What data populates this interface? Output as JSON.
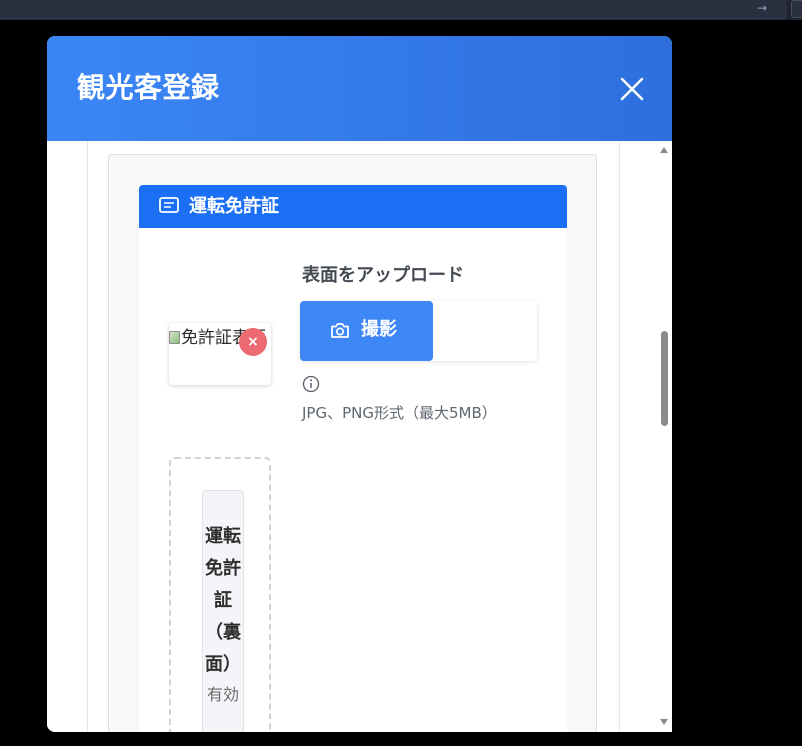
{
  "modal": {
    "title": "観光客登録",
    "close_icon": "close-icon"
  },
  "license_card": {
    "icon": "card-icon",
    "title": "運転免許証",
    "front": {
      "image_alt": "免許証表面",
      "remove_label": "×",
      "remove_color": "#ec6a72",
      "upload_heading": "表面をアップロード",
      "shoot_label": "撮影",
      "shoot_icon": "camera-icon",
      "info_icon": "info-icon",
      "format_hint": "JPG、PNG形式（最大5MB）"
    },
    "back": {
      "title": "運転免許証（裏面）",
      "subtitle": "有効"
    }
  },
  "colors": {
    "header_gradient_start": "#3b86f7",
    "header_gradient_end": "#2e6fdc",
    "card_header": "#1a6ff5",
    "primary_button": "#3f86f6"
  }
}
